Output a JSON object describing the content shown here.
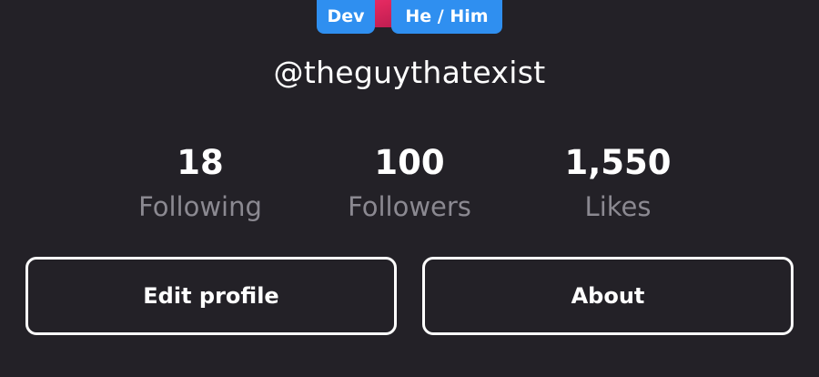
{
  "profile": {
    "badges": [
      "Dev",
      "He / Him"
    ],
    "username": "@theguythatexist"
  },
  "stats": [
    {
      "value": "18",
      "label": "Following"
    },
    {
      "value": "100",
      "label": "Followers"
    },
    {
      "value": "1,550",
      "label": "Likes"
    }
  ],
  "actions": {
    "edit_profile_label": "Edit profile",
    "about_label": "About"
  },
  "colors": {
    "background": "#232127",
    "badge": "#2f8ff0",
    "label_gray": "#8b8991",
    "avatar_accent": "#e0285e"
  }
}
